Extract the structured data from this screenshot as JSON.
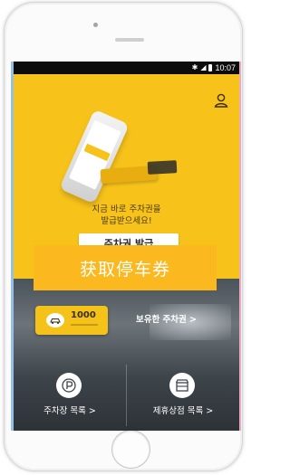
{
  "status_bar": {
    "time": "10:07"
  },
  "hero": {
    "subtitle": "지금 바로 주차권을\n발급받으세요!",
    "issue_button": "주차권 발급"
  },
  "overlay": {
    "banner_text": "获取停车券"
  },
  "ticket": {
    "amount": "1000",
    "owned_link": "보유한 주차권 >"
  },
  "tiles": [
    {
      "label": "주차장 목록 >",
      "icon": "parking-icon"
    },
    {
      "label": "제휴상점 목록 >",
      "icon": "store-icon"
    }
  ],
  "colors": {
    "brand_yellow": "#f7c31b",
    "overlay_orange": "#fbb91f",
    "status_bar": "#0c0c0c"
  }
}
